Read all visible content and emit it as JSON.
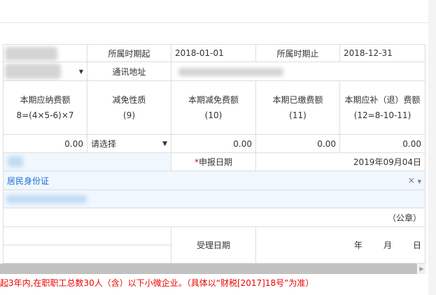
{
  "period_start_label": "所属时期起",
  "period_start": "2018-01-01",
  "period_end_label": "所属时期止",
  "period_end": "2018-12-31",
  "address_label": "通讯地址",
  "headers": [
    {
      "title": "本期应纳费额",
      "formula": "8=(4×5-6)×7"
    },
    {
      "title": "减免性质",
      "formula": "(9)"
    },
    {
      "title": "本期减免费额",
      "formula": "(10)"
    },
    {
      "title": "本期已缴费额",
      "formula": "(11)"
    },
    {
      "title": "本期应补（退）费额",
      "formula": "(12=8-10-11)"
    }
  ],
  "values": {
    "payable": "0.00",
    "reduction_select": "请选择",
    "reduced": "0.00",
    "paid": "0.00",
    "due": "0.00"
  },
  "filing_date_label": "申报日期",
  "filing_date": "2019年09月04日",
  "required_mark": "*",
  "id_type": "居民身份证",
  "clear_symbol": "×",
  "seal_label": "（公章）",
  "accept_date_label": "受理日期",
  "year": "年",
  "month": "月",
  "day": "日",
  "note": "起3年内,在职职工总数30人（含）以下小微企业。（具体以“财税[2017]18号”为准）"
}
